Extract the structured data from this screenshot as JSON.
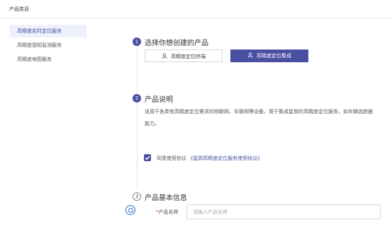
{
  "header": {
    "title": "产品类目"
  },
  "sidebar": {
    "items": [
      {
        "label": "高精度实时定位服务",
        "active": true
      },
      {
        "label": "高精度感知监测服务",
        "active": false
      },
      {
        "label": "高精度地图服务",
        "active": false
      }
    ]
  },
  "steps": [
    {
      "number": "1",
      "title": "选择你想创建的产品"
    },
    {
      "number": "2",
      "title": "产品说明"
    },
    {
      "number": "3",
      "title": "产品基本信息"
    }
  ],
  "product_options": [
    {
      "label": "高精度定位终端",
      "selected": false,
      "icon": "user-icon"
    },
    {
      "label": "高精度定位集成",
      "selected": true,
      "icon": "user-icon"
    }
  ],
  "description": {
    "line1": "适用于各类有高精度定位需求的物联网、车联网等设备，用于集成星舆的高精度定位服务，如车辆追踪器",
    "line2": "能力。"
  },
  "agreement": {
    "prefix": "同意使用协议",
    "link": "《星舆高精度定位服务使用协议》",
    "checked": true
  },
  "form": {
    "name_label": "产品名称",
    "required_mark": "*",
    "name_placeholder": "请输入产品名称",
    "name_value": ""
  },
  "colors": {
    "accent": "#4a4fa3",
    "helper": "#2b6fc9"
  }
}
